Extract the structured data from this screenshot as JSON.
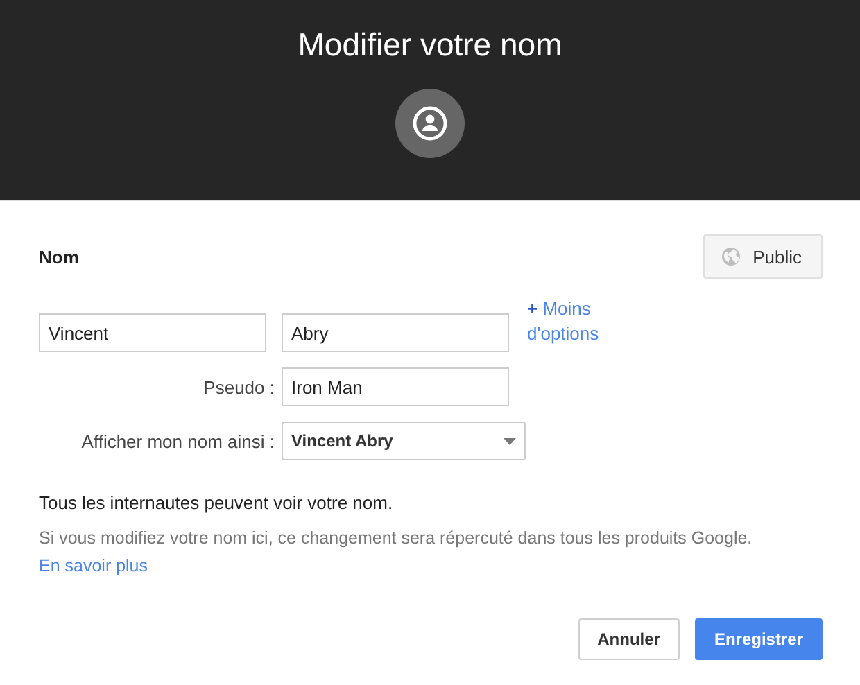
{
  "header": {
    "title": "Modifier votre nom"
  },
  "section": {
    "title": "Nom",
    "visibility_button": "Public"
  },
  "name_fields": [
    {
      "value": "Vincent"
    },
    {
      "value": "Abry"
    }
  ],
  "options_link": {
    "symbol": "+",
    "label": "Moins d'options"
  },
  "nickname": {
    "label": "Pseudo :",
    "value": "Iron Man"
  },
  "display_as": {
    "label": "Afficher mon nom ainsi :",
    "value": "Vincent Abry"
  },
  "notice": "Tous les internautes peuvent voir votre nom.",
  "info": {
    "text": "Si vous modifiez votre nom ici, ce changement sera répercuté dans tous les produits Google.",
    "link": "En savoir plus"
  },
  "buttons": [
    {
      "label": "Annuler",
      "kind": "secondary"
    },
    {
      "label": "Enregistrer",
      "kind": "primary"
    }
  ]
}
